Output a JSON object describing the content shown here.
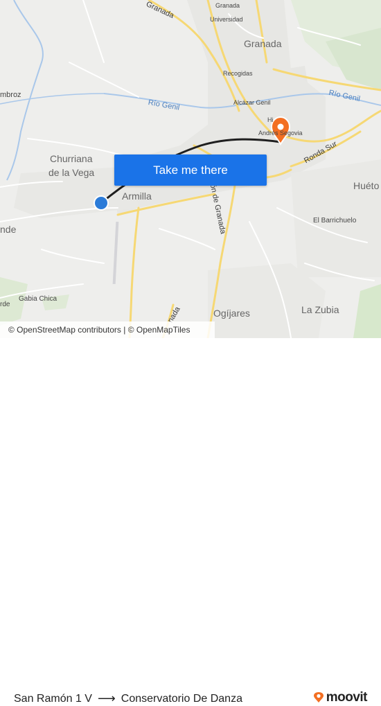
{
  "map": {
    "labels": {
      "granada_road": "Granada",
      "granada_top": "Granada",
      "universidad": "Universidad",
      "granada": "Granada",
      "recogidas": "Recogidas",
      "alcazar_genil": "Alcázar Genil",
      "rio_genil_left": "Río Genil",
      "rio_genil_right": "Río Genil",
      "churriana_1": "Churriana",
      "churriana_2": "de la Vega",
      "armilla": "Armilla",
      "ronda_sur": "Ronda Sur",
      "huetor": "Huéto",
      "el_barrichuelo": "El Barrichuelo",
      "gabia_chica": "Gabia Chica",
      "ogijares": "Ogíjares",
      "la_zubia": "La Zubia",
      "ambroz": "mbroz",
      "nde": "nde",
      "rde": "rde",
      "hi": "Hi",
      "andrea_segovia": "Andrés Segovia",
      "camino_granada": "ión de Granada",
      "nada": "nada"
    },
    "origin_marker_color": "#2b7bd8",
    "destination_marker_color": "#f36f22",
    "route_color": "#1f1f1f",
    "cta_label": "Take me there"
  },
  "attribution": {
    "text": "© OpenStreetMap contributors | © OpenMapTiles"
  },
  "footer": {
    "origin": "San Ramón 1 V",
    "arrow": "⟶",
    "destination": "Conservatorio De Danza",
    "brand": "moovit",
    "brand_color": "#f36f22"
  }
}
